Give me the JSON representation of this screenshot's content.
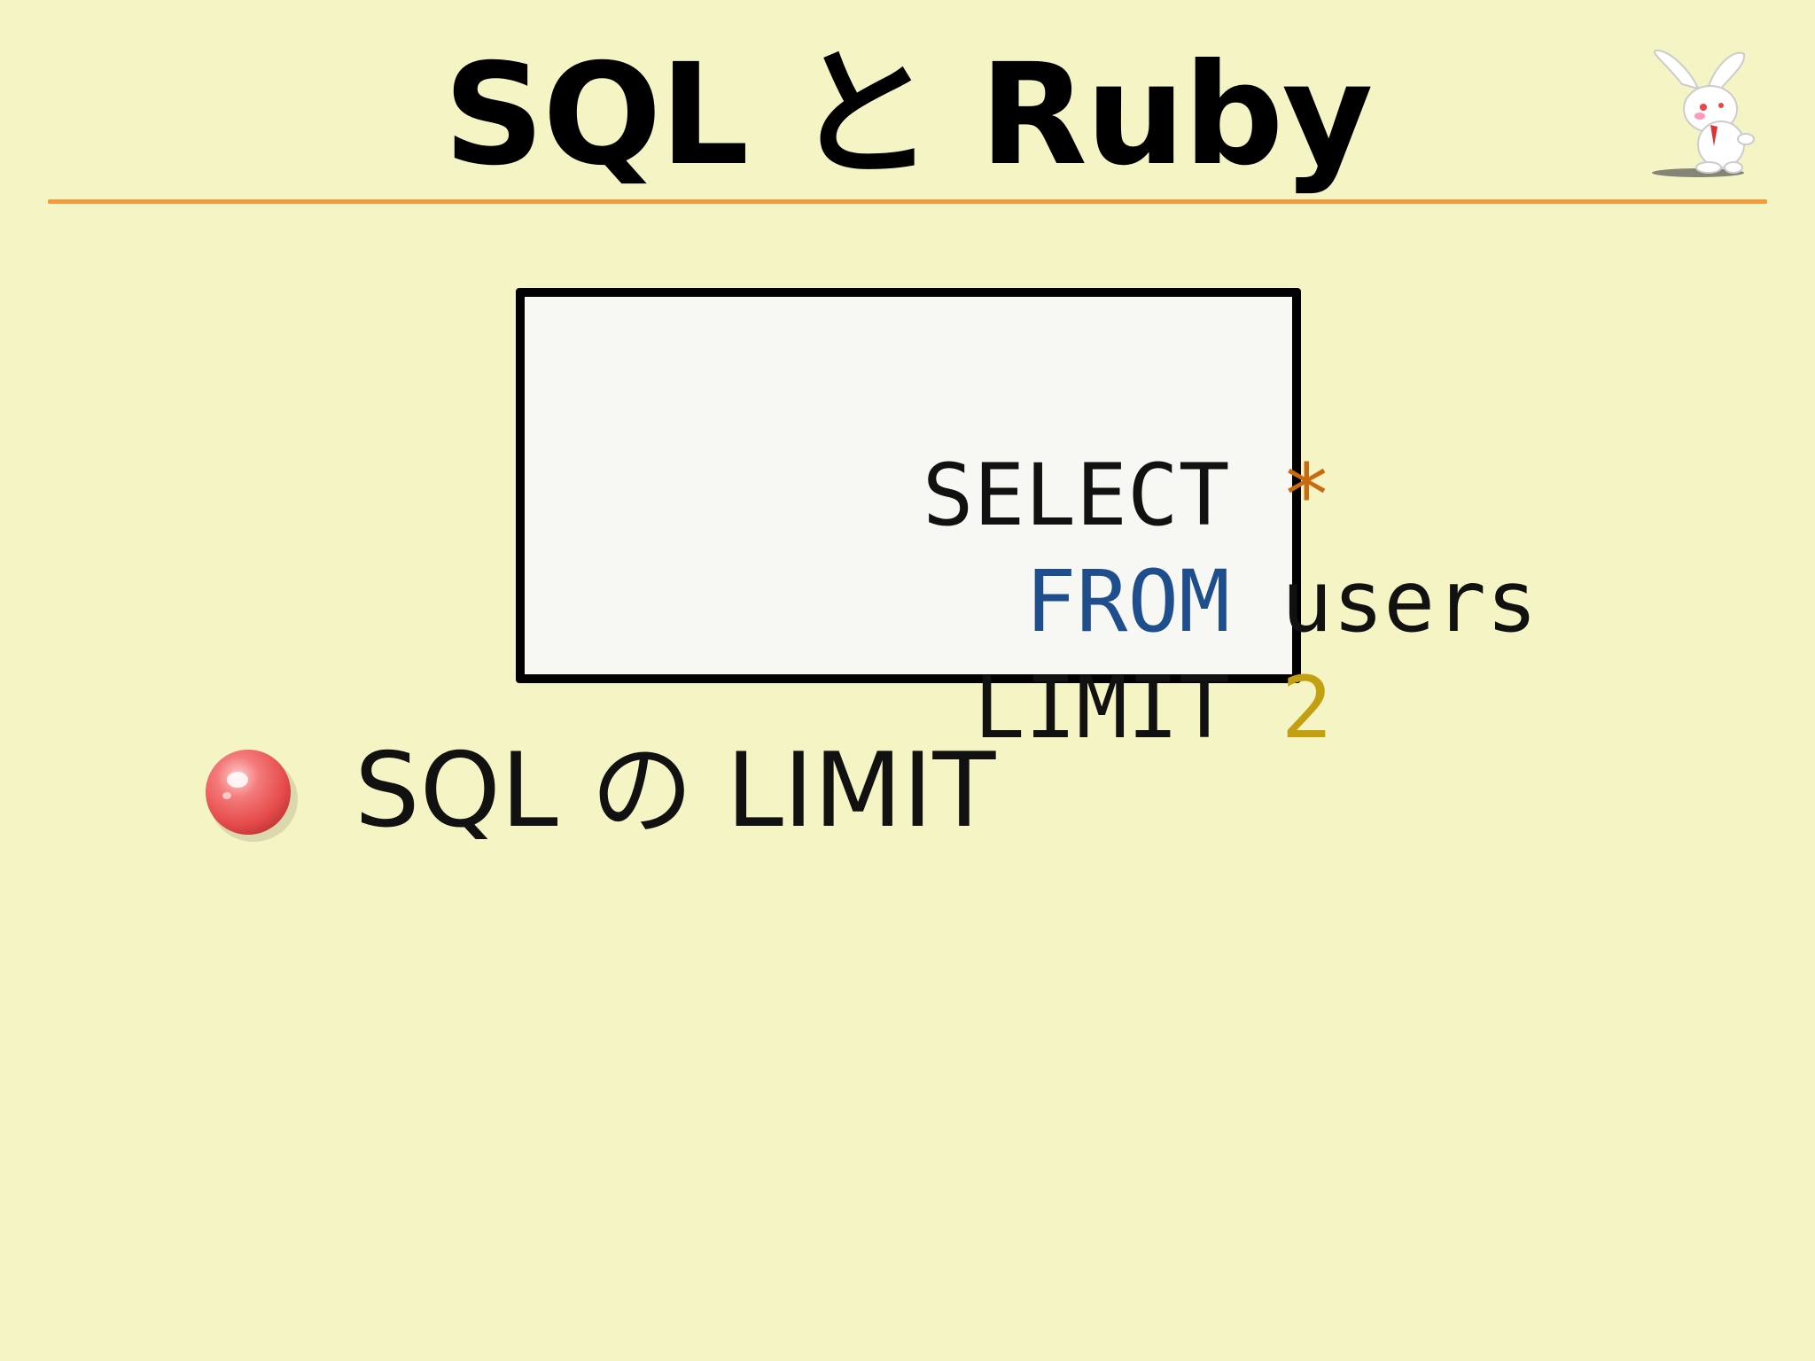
{
  "slide": {
    "title": "SQL と Ruby",
    "mascot_icon": "rabbit-mascot-icon",
    "accent_rule_color": "#f39a3c",
    "background_color": "#f5f4c5"
  },
  "code_block": {
    "lines": [
      {
        "tokens": [
          {
            "text": "SELECT",
            "kind": "keyword",
            "color": "#111111"
          },
          {
            "text": " ",
            "kind": "space"
          },
          {
            "text": "*",
            "kind": "operator",
            "color": "#c96a10"
          }
        ]
      },
      {
        "tokens": [
          {
            "text": "FROM",
            "kind": "keyword",
            "color": "#1f4e8c"
          },
          {
            "text": " ",
            "kind": "space"
          },
          {
            "text": "users",
            "kind": "identifier",
            "color": "#111111"
          }
        ]
      },
      {
        "tokens": [
          {
            "text": "LIMIT",
            "kind": "keyword",
            "color": "#111111"
          },
          {
            "text": " ",
            "kind": "space"
          },
          {
            "text": "2",
            "kind": "number",
            "color": "#c2a012"
          }
        ]
      }
    ]
  },
  "bullets": [
    {
      "icon": "red-bullet-icon",
      "text": "SQL の LIMIT"
    }
  ]
}
